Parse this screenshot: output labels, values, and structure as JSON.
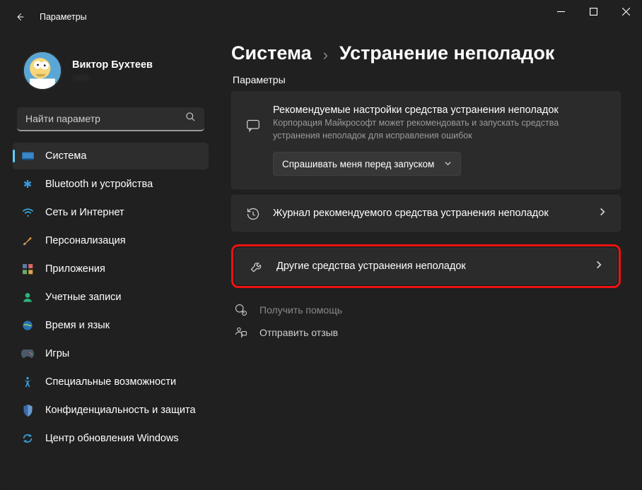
{
  "window": {
    "title": "Параметры"
  },
  "profile": {
    "name": "Виктор Бухтеев",
    "email": "——"
  },
  "search": {
    "placeholder": "Найти параметр"
  },
  "sidebar": {
    "items": [
      {
        "label": "Система"
      },
      {
        "label": "Bluetooth и устройства"
      },
      {
        "label": "Сеть и Интернет"
      },
      {
        "label": "Персонализация"
      },
      {
        "label": "Приложения"
      },
      {
        "label": "Учетные записи"
      },
      {
        "label": "Время и язык"
      },
      {
        "label": "Игры"
      },
      {
        "label": "Специальные возможности"
      },
      {
        "label": "Конфиденциальность и защита"
      },
      {
        "label": "Центр обновления Windows"
      }
    ]
  },
  "breadcrumb": {
    "root": "Система",
    "leaf": "Устранение неполадок"
  },
  "section_label": "Параметры",
  "cards": {
    "recommended": {
      "title": "Рекомендуемые настройки средства устранения неполадок",
      "subtitle": "Корпорация Майкрософт может рекомендовать и запускать средства устранения неполадок для исправления ошибок",
      "dropdown": "Спрашивать меня перед запуском"
    },
    "history": {
      "title": "Журнал рекомендуемого средства устранения неполадок"
    },
    "other": {
      "title": "Другие средства устранения неполадок"
    }
  },
  "footer": {
    "help": "Получить помощь",
    "feedback": "Отправить отзыв"
  }
}
